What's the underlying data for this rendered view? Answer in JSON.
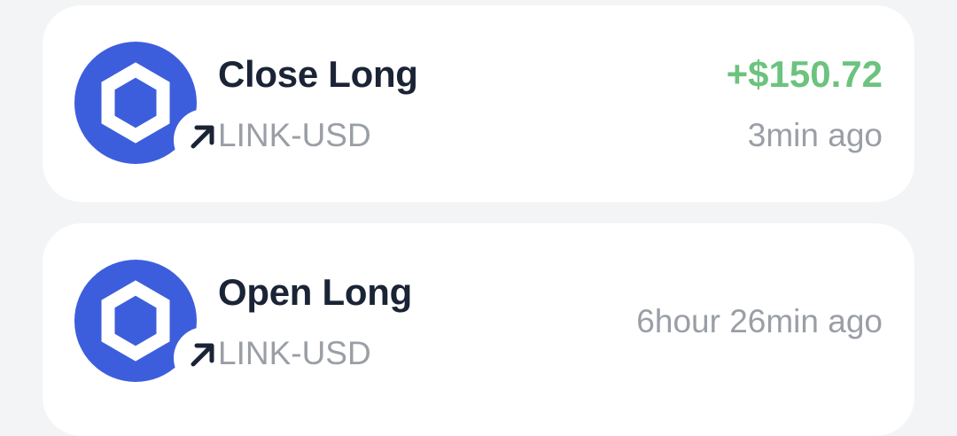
{
  "transactions": [
    {
      "title": "Close Long",
      "pair": "LINK-USD",
      "amount": "+$150.72",
      "time": "3min ago",
      "icon": "chainlink-logo",
      "badge_icon": "arrow-up-right-icon"
    },
    {
      "title": "Open Long",
      "pair": "LINK-USD",
      "amount": "",
      "time": "6hour 26min ago",
      "icon": "chainlink-logo",
      "badge_icon": "arrow-up-right-icon"
    }
  ],
  "colors": {
    "background": "#f3f4f5",
    "card": "#ffffff",
    "token_blue": "#3d5edc",
    "profit_green": "#6cc37e",
    "title": "#1b2436",
    "muted": "#9a9ea6"
  }
}
